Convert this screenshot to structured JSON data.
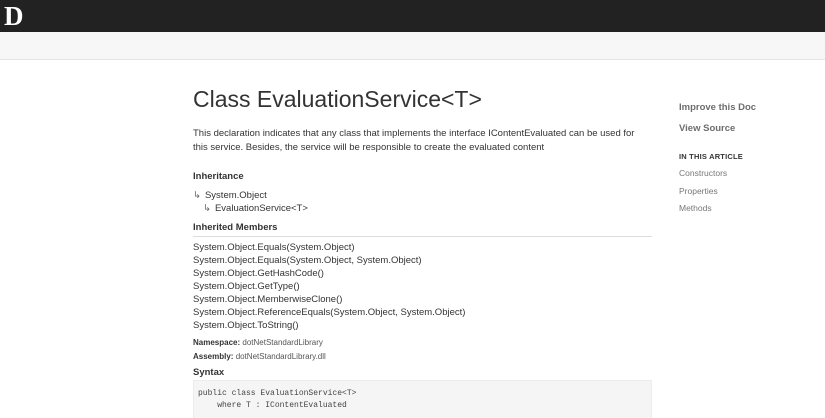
{
  "header": {
    "logo_letter": "D"
  },
  "article": {
    "title": "Class EvaluationService<T>",
    "summary": "This declaration indicates that any class that implements the interface IContentEvaluated can be used for this service. Besides, the service will be responsible to create the evaluated content",
    "inheritance_heading": "Inheritance",
    "inheritance": [
      "System.Object",
      "EvaluationService<T>"
    ],
    "inherited_members_heading": "Inherited Members",
    "inherited_members": [
      "System.Object.Equals(System.Object)",
      "System.Object.Equals(System.Object, System.Object)",
      "System.Object.GetHashCode()",
      "System.Object.GetType()",
      "System.Object.MemberwiseClone()",
      "System.Object.ReferenceEquals(System.Object, System.Object)",
      "System.Object.ToString()"
    ],
    "namespace_label": "Namespace",
    "namespace_value": "dotNetStandardLibrary",
    "assembly_label": "Assembly",
    "assembly_value": "dotNetStandardLibrary.dll",
    "syntax_heading": "Syntax",
    "syntax_lines": [
      "public class EvaluationService<T>",
      "    where T : IContentEvaluated"
    ]
  },
  "aside": {
    "improve_link": "Improve this Doc",
    "view_source_link": "View Source",
    "in_this_article": "IN THIS ARTICLE",
    "toc": [
      "Constructors",
      "Properties",
      "Methods"
    ]
  },
  "icons": {
    "inheritance_arrow": "↳"
  }
}
